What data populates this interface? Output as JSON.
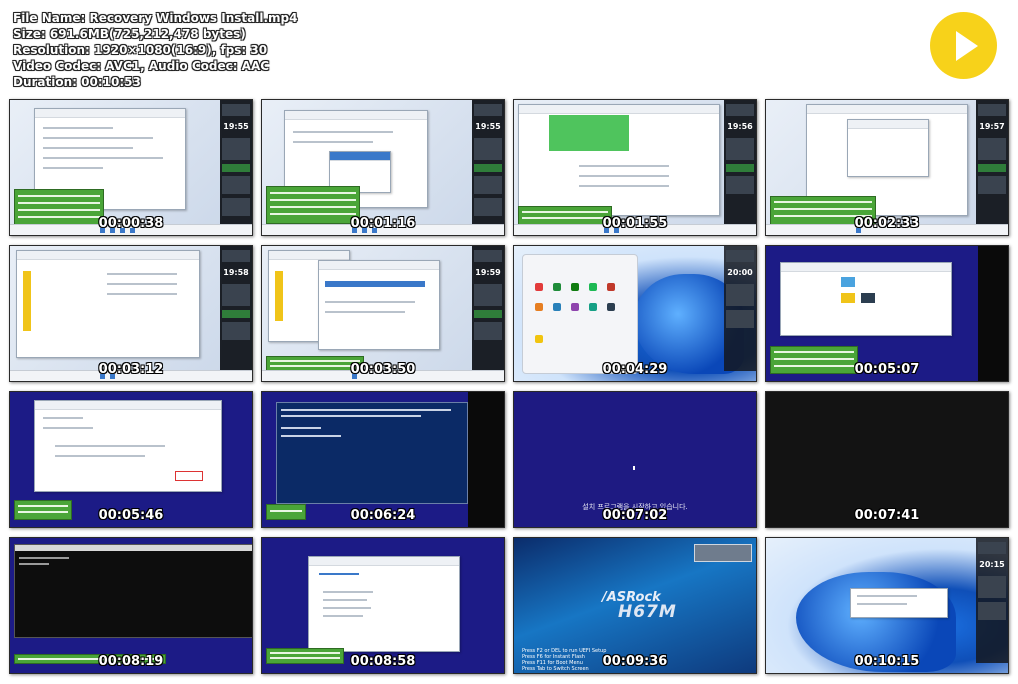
{
  "header": {
    "file_name": "File Name: Recovery Windows Install.mp4",
    "size": "Size: 691.6MB(725,212,478 bytes)",
    "resolution": "Resolution: 1920×1080(16:9), fps: 30",
    "codec": "Video Codec: AVC1, Audio Codec: AAC",
    "duration": "Duration: 00:10:53"
  },
  "play_button": {
    "icon": "play-icon",
    "color": "#f7d21a"
  },
  "thumbnails": [
    {
      "timestamp": "00:00:38",
      "clock": "19:55",
      "scene": "desktop-dialog"
    },
    {
      "timestamp": "00:01:16",
      "clock": "19:55",
      "scene": "desktop-dialog"
    },
    {
      "timestamp": "00:01:55",
      "clock": "19:56",
      "scene": "desktop-explorer"
    },
    {
      "timestamp": "00:02:33",
      "clock": "19:57",
      "scene": "desktop-explorer"
    },
    {
      "timestamp": "00:03:12",
      "clock": "19:58",
      "scene": "desktop-explorer"
    },
    {
      "timestamp": "00:03:50",
      "clock": "19:59",
      "scene": "desktop-dialog"
    },
    {
      "timestamp": "00:04:29",
      "clock": "20:00",
      "scene": "start-menu"
    },
    {
      "timestamp": "00:05:07",
      "scene": "blue-dialog"
    },
    {
      "timestamp": "00:05:46",
      "scene": "blue-dialog"
    },
    {
      "timestamp": "00:06:24",
      "scene": "blue-console"
    },
    {
      "timestamp": "00:07:02",
      "scene": "setup-start",
      "caption": "설치 프로그램을 시작하고 있습니다."
    },
    {
      "timestamp": "00:07:41",
      "scene": "black"
    },
    {
      "timestamp": "00:08:19",
      "scene": "black-console"
    },
    {
      "timestamp": "00:08:58",
      "scene": "blue-setup"
    },
    {
      "timestamp": "00:09:36",
      "scene": "asrock",
      "brand": "/ASRock",
      "model": "H67M",
      "boot_lines": [
        "Press F2 or DEL to run UEFI Setup",
        "Press F6 for Instant Flash",
        "Press F11 for Boot Menu",
        "Press Tab to Switch Screen"
      ]
    },
    {
      "timestamp": "00:10:15",
      "clock": "20:15",
      "scene": "win11-desktop"
    }
  ]
}
